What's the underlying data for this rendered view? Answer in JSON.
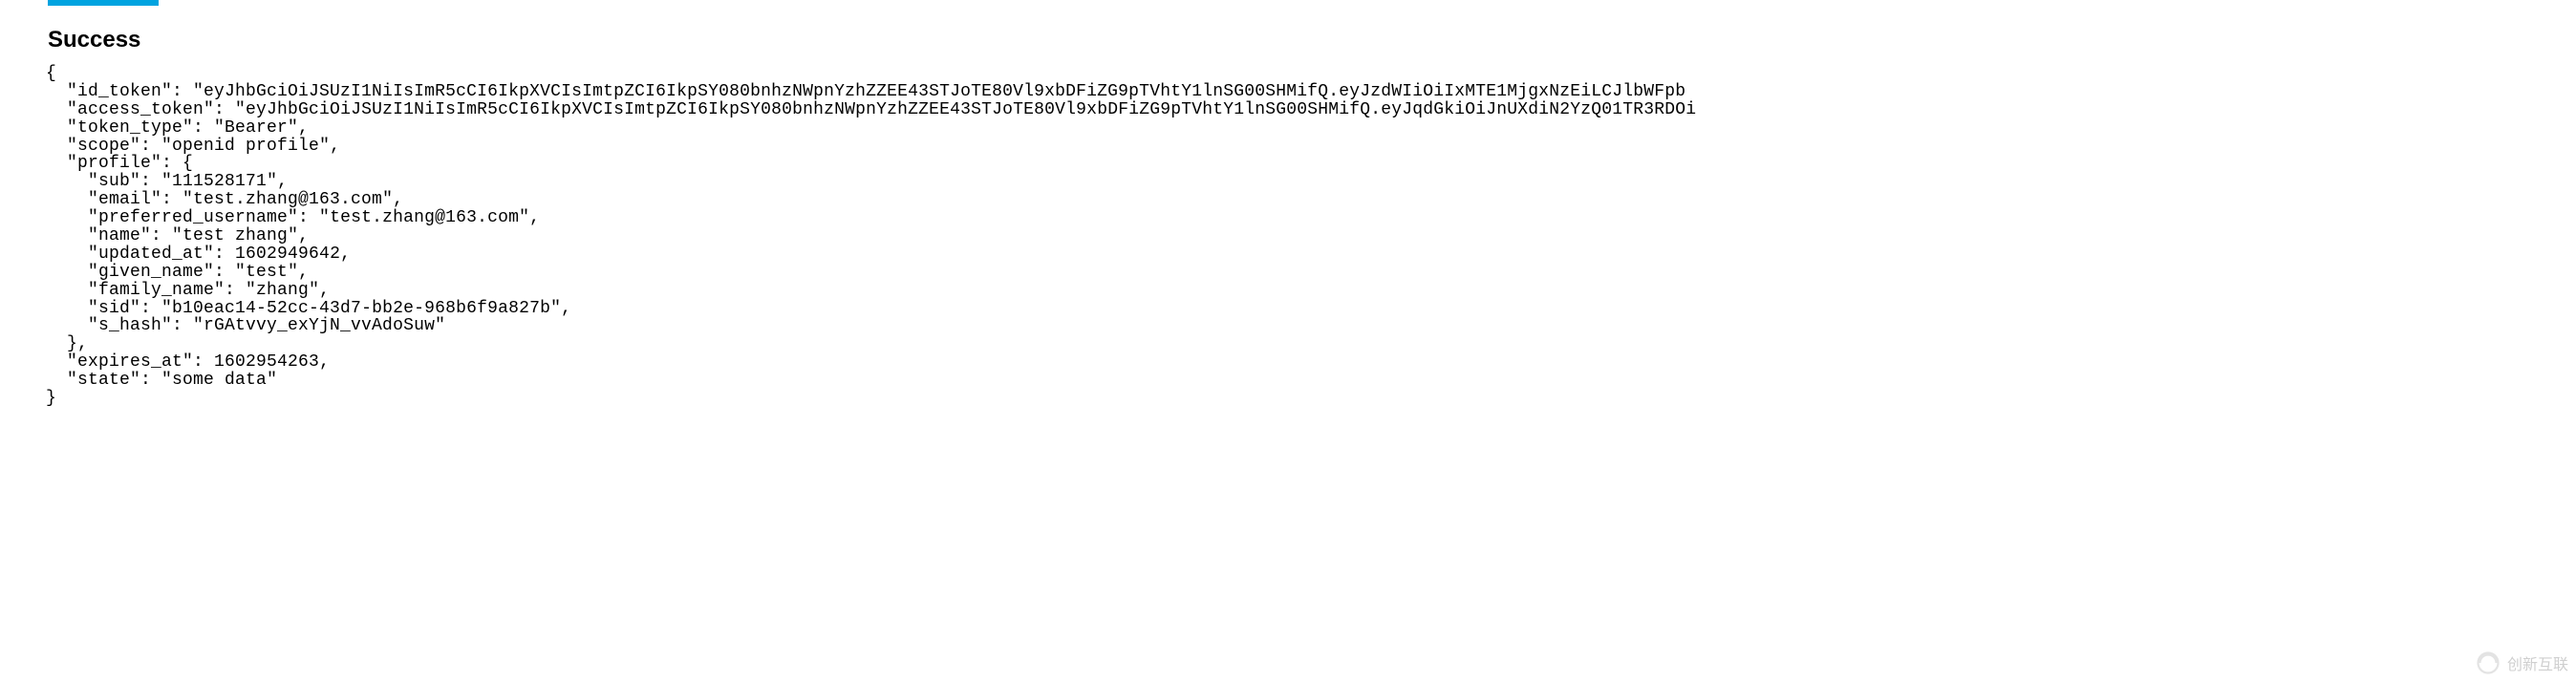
{
  "title": "Success",
  "json_data": {
    "id_token": "eyJhbGciOiJSUzI1NiIsImR5cCI6IkpXVCIsImtpZCI6IkpSY080bnhzNWpnYzhZZEE43STJoTE80Vl9xbDFiZG9pTVhtY1lnSG00SHMifQ.eyJzdWIiOiIxMTE1MjgxNzEiLCJlbWFpb",
    "access_token": "eyJhbGciOiJSUzI1NiIsImR5cCI6IkpXVCIsImtpZCI6IkpSY080bnhzNWpnYzhZZEE43STJoTE80Vl9xbDFiZG9pTVhtY1lnSG00SHMifQ.eyJqdGkiOiJnUXdiN2YzQ01TR3RDOi",
    "token_type": "Bearer",
    "scope": "openid profile",
    "profile": {
      "sub": "111528171",
      "email": "test.zhang@163.com",
      "preferred_username": "test.zhang@163.com",
      "name": "test zhang",
      "updated_at": 1602949642,
      "given_name": "test",
      "family_name": "zhang",
      "sid": "b10eac14-52cc-43d7-bb2e-968b6f9a827b",
      "s_hash": "rGAtvvy_exYjN_vvAdoSuw"
    },
    "expires_at": 1602954263,
    "state": "some data"
  },
  "watermark": "创新互联"
}
